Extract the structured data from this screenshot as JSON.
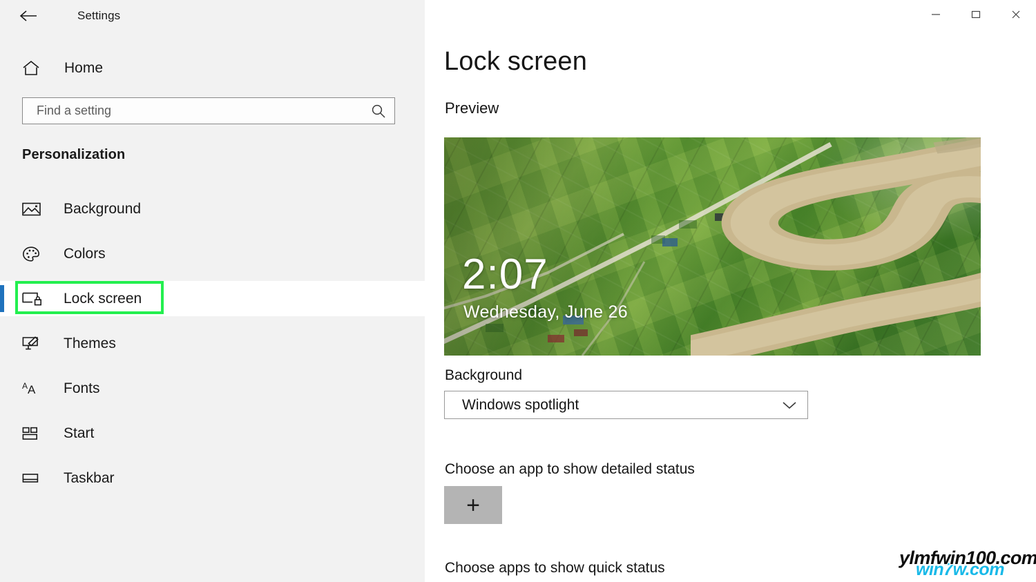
{
  "window": {
    "title": "Settings",
    "back_icon": "back-arrow-icon",
    "controls": {
      "minimize": "—",
      "maximize": "☐",
      "close": "✕"
    }
  },
  "sidebar": {
    "home_label": "Home",
    "home_icon": "home-icon",
    "search": {
      "placeholder": "Find a setting",
      "value": "",
      "icon": "search-icon"
    },
    "section_title": "Personalization",
    "items": [
      {
        "label": "Background",
        "icon": "picture-icon",
        "selected": false
      },
      {
        "label": "Colors",
        "icon": "palette-icon",
        "selected": false
      },
      {
        "label": "Lock screen",
        "icon": "lock-screen-icon",
        "selected": true
      },
      {
        "label": "Themes",
        "icon": "themes-icon",
        "selected": false
      },
      {
        "label": "Fonts",
        "icon": "fonts-icon",
        "selected": false
      },
      {
        "label": "Start",
        "icon": "start-icon",
        "selected": false
      },
      {
        "label": "Taskbar",
        "icon": "taskbar-icon",
        "selected": false
      }
    ],
    "highlight_color": "#23ef4f",
    "accent_color": "#1f72bd"
  },
  "main": {
    "page_title": "Lock screen",
    "preview_heading": "Preview",
    "preview": {
      "clock": "2:07",
      "date": "Wednesday, June 26",
      "image_description": "aerial view of green rice paddy fields with a winding tan river"
    },
    "background_section": {
      "label": "Background",
      "selected_value": "Windows spotlight",
      "chevron_icon": "chevron-down-icon"
    },
    "detailed_status": {
      "label": "Choose an app to show detailed status",
      "add_icon": "plus-icon"
    },
    "quick_status": {
      "label": "Choose apps to show quick status"
    }
  },
  "watermark": {
    "primary": "ylmfwin100.com",
    "secondary": "win7w.com"
  }
}
